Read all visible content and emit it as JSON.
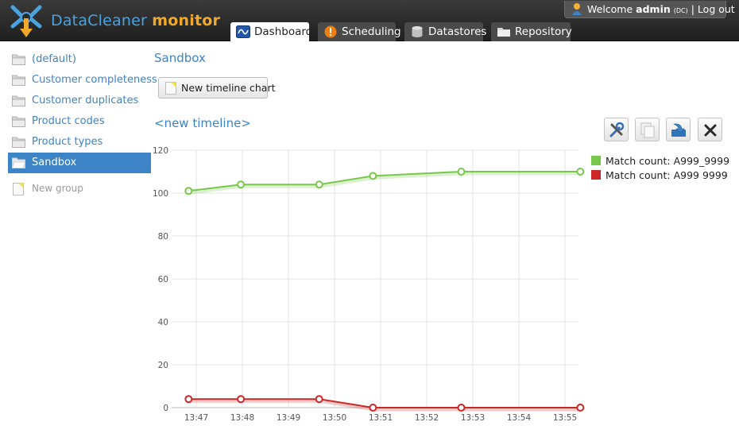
{
  "app": {
    "name_part1": "DataCleaner",
    "name_part2": "monitor",
    "colors": {
      "blue": "#4aa3df",
      "orange": "#f0a92b"
    }
  },
  "user": {
    "welcome": "Welcome",
    "username": "admin",
    "tenant": "(DC)",
    "separator": " | ",
    "logout": "Log out"
  },
  "tabs": [
    {
      "label": "Dashboard",
      "icon": "timeline-icon",
      "active": true
    },
    {
      "label": "Scheduling",
      "icon": "warning-icon",
      "active": false
    },
    {
      "label": "Datastores",
      "icon": "database-icon",
      "active": false
    },
    {
      "label": "Repository",
      "icon": "folder-icon",
      "active": false
    }
  ],
  "sidebar": {
    "items": [
      {
        "label": "(default)"
      },
      {
        "label": "Customer completeness"
      },
      {
        "label": "Customer duplicates"
      },
      {
        "label": "Product codes"
      },
      {
        "label": "Product types"
      },
      {
        "label": "Sandbox",
        "active": true
      }
    ],
    "new_group": "New group"
  },
  "main": {
    "title": "Sandbox",
    "new_chart_button": "New timeline chart",
    "timeline_title": "<new timeline>",
    "tools": [
      "customize-icon",
      "copy-icon",
      "save-icon",
      "close-icon"
    ]
  },
  "chart_data": {
    "type": "line",
    "x_ticks": [
      "13:47",
      "13:48",
      "13:49",
      "13:50",
      "13:51",
      "13:52",
      "13:53",
      "13:54",
      "13:55"
    ],
    "ylim": [
      0,
      120
    ],
    "y_ticks": [
      0,
      20,
      40,
      60,
      80,
      100,
      120
    ],
    "grid": true,
    "legend_position": "right",
    "series": [
      {
        "name": "Match count: A999_9999",
        "color": "#77c84a",
        "x": [
          "13:46:50",
          "13:47:58",
          "13:49:40",
          "13:50:50",
          "13:52:45",
          "13:55:20"
        ],
        "values": [
          101,
          104,
          104,
          108,
          110,
          110
        ]
      },
      {
        "name": "Match count: A999 9999",
        "color": "#cc2727",
        "x": [
          "13:46:50",
          "13:47:58",
          "13:49:40",
          "13:50:50",
          "13:52:45",
          "13:55:20"
        ],
        "values": [
          4,
          4,
          4,
          0,
          0,
          0
        ]
      }
    ]
  }
}
